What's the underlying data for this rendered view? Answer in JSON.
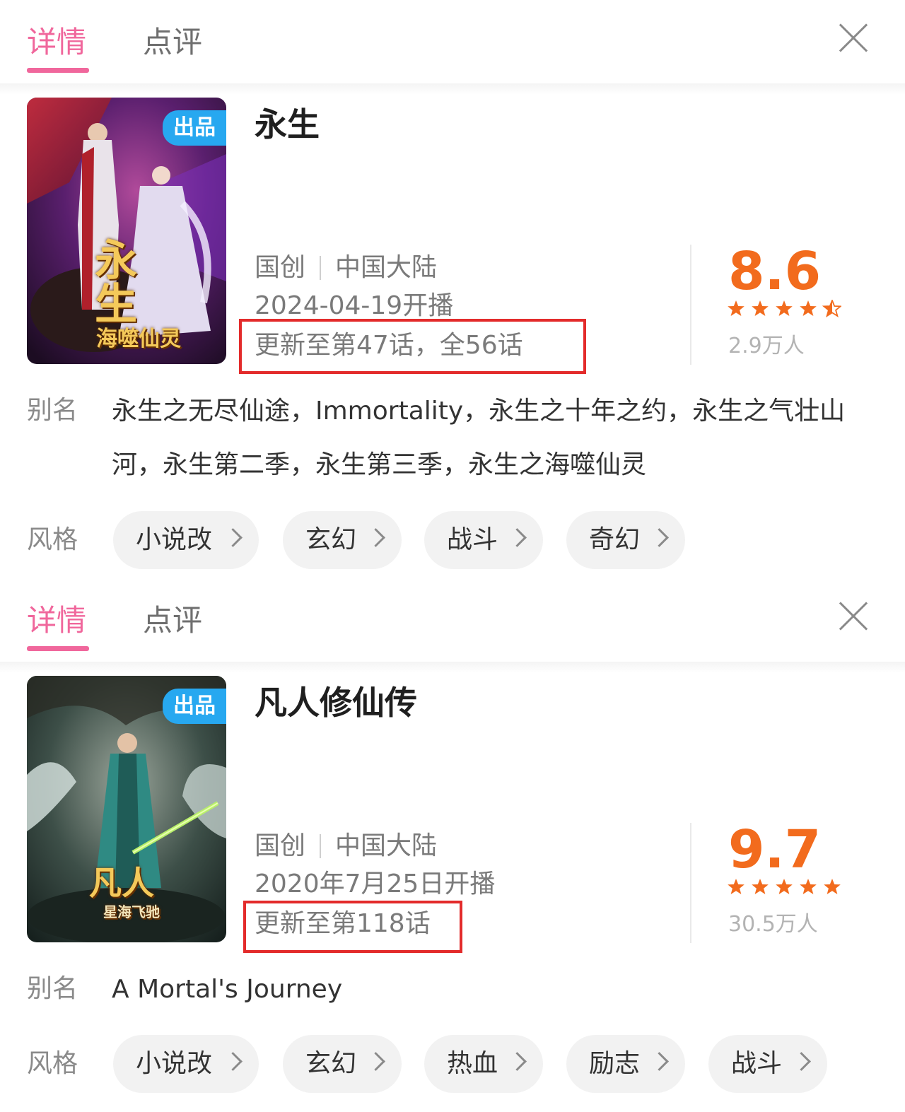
{
  "colors": {
    "accent": "#f0679c",
    "score": "#f26b1d",
    "highlight_box": "#e32b2b",
    "badge": "#27a8f0"
  },
  "panels": [
    {
      "tabs": [
        {
          "label": "详情",
          "active": true
        },
        {
          "label": "点评",
          "active": false
        }
      ],
      "cover": {
        "badge": "出品",
        "logo_main": "永生",
        "logo_sub": "海噬仙灵"
      },
      "title": "永生",
      "category": "国创",
      "region": "中国大陆",
      "release": "2024-04-19开播",
      "progress": "更新至第47话，全56话",
      "rating": {
        "score": "8.6",
        "stars": 4.5,
        "votes": "2.9万人"
      },
      "alias_label": "别名",
      "alias": "永生之无尽仙途，Immortality，永生之十年之约，永生之气壮山河，永生第二季，永生第三季，永生之海噬仙灵",
      "style_label": "风格",
      "tags": [
        "小说改",
        "玄幻",
        "战斗",
        "奇幻"
      ]
    },
    {
      "tabs": [
        {
          "label": "详情",
          "active": true
        },
        {
          "label": "点评",
          "active": false
        }
      ],
      "cover": {
        "badge": "出品",
        "logo_main": "凡人",
        "logo_sub": "星海飞驰"
      },
      "title": "凡人修仙传",
      "category": "国创",
      "region": "中国大陆",
      "release": "2020年7月25日开播",
      "progress": "更新至第118话",
      "rating": {
        "score": "9.7",
        "stars": 5,
        "votes": "30.5万人"
      },
      "alias_label": "别名",
      "alias": "A Mortal's Journey",
      "style_label": "风格",
      "tags": [
        "小说改",
        "玄幻",
        "热血",
        "励志",
        "战斗"
      ]
    }
  ]
}
